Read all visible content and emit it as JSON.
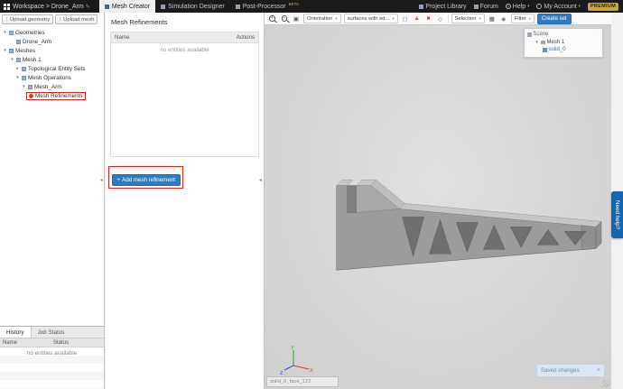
{
  "topbar": {
    "breadcrumb": "Workspace > Drone_Arm",
    "tabs": [
      {
        "label": "Mesh Creator"
      },
      {
        "label": "Simulation Designer"
      },
      {
        "label": "Post-Processor",
        "badge": "BETA"
      }
    ],
    "links": {
      "project_library": "Project Library",
      "forum": "Forum",
      "help": "Help",
      "account": "My Account"
    },
    "premium": "PREMIUM"
  },
  "sidebar": {
    "upload_geometry": "Upload geometry",
    "upload_mesh": "Upload mesh",
    "tree": [
      {
        "label": "Geometries"
      },
      {
        "label": "Drone_Arm"
      },
      {
        "label": "Meshes"
      },
      {
        "label": "Mesh 1"
      },
      {
        "label": "Topological Entity Sets"
      },
      {
        "label": "Mesh Operations"
      },
      {
        "label": "Mesh_Arm"
      },
      {
        "label": "Mesh Refinements"
      }
    ],
    "history": {
      "tabs": [
        "History",
        "Job Status"
      ],
      "headers": [
        "Name",
        "Status"
      ],
      "empty": "no entities available"
    }
  },
  "panel": {
    "title": "Mesh Refinements",
    "headers": [
      "Name",
      "Actions"
    ],
    "empty": "no entities available",
    "add_button": "Add mesh refinement"
  },
  "viewport": {
    "toolbar": {
      "orientation": "Orientation",
      "display_mode": "surfaces with ed...",
      "selection": "Selection",
      "filter": "Filter",
      "create_set": "Create set"
    },
    "scene": {
      "title": "Scene",
      "items": [
        "Mesh 1",
        "solid_0"
      ]
    },
    "face_label": "solid_0_face_122",
    "toast": {
      "text": "Saved changes",
      "close": "×"
    },
    "axes": {
      "x": "X",
      "y": "Y",
      "z": "Z"
    }
  },
  "help_tab": "Need help?",
  "colors": {
    "accent_blue": "#2e7bbf",
    "annotation_red": "#ec1c12",
    "premium_gold": "#caa53d",
    "viewport_gray": "#d4d4d4"
  },
  "icons": {
    "plus": "+",
    "minus": "−",
    "fit_view": "▣",
    "caret": "▾",
    "tree_open": "▾",
    "tree_closed": "▸",
    "upload": "↑",
    "edit": "✎",
    "help_q": "?",
    "pointer": "◻",
    "tool_red_a": "▲",
    "tool_red_b": "■",
    "tool_alt": "◇",
    "box_select": "▦",
    "invert": "◈",
    "collapse": "◂"
  }
}
